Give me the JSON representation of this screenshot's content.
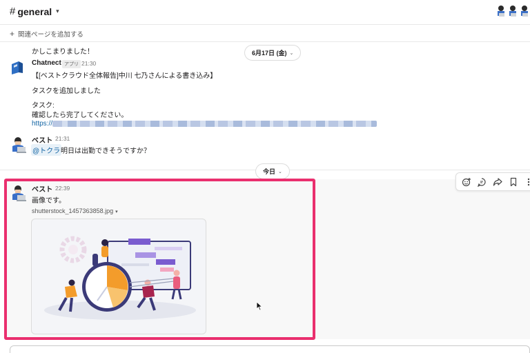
{
  "header": {
    "hash": "#",
    "channel_name": "general",
    "chevron": "▾",
    "members_icon": "member-avatars-icon"
  },
  "bookmarks": {
    "plus": "+",
    "add_page_label": "関連ページを追加する"
  },
  "messages": [
    {
      "text": "かしこまりました！"
    },
    {
      "sender": "Chatnect",
      "badge": "アプリ",
      "time": "21:30",
      "line1": "【[ベストクラウド全体報告]中川 七乃さんによる書き込み】",
      "line2": "タスクを追加しました",
      "line3": "タスク:",
      "line4": "確認したら完了してください。",
      "link_prefix": "https://"
    },
    {
      "sender": "ベスト",
      "time": "21:31",
      "mention": "@トクラ",
      "text": "明日は出勤できそうですか？"
    }
  ],
  "dividers": {
    "june": "6月17日 (金)",
    "today": "今日",
    "chevron": "⌄"
  },
  "highlighted_message": {
    "sender": "ベスト",
    "time": "22:39",
    "text": "画像です。",
    "file_name": "shutterstock_1457363858.jpg",
    "file_chevron": "▾",
    "highlight_color": "#ea2f6e"
  },
  "toolbar": {
    "icons": [
      "add-reaction-icon",
      "reply-thread-icon",
      "share-icon",
      "bookmark-icon",
      "more-actions-icon"
    ]
  },
  "colors": {
    "link": "#1264a3",
    "accent_orange": "#f39c2b",
    "accent_purple": "#7a5ccf"
  }
}
